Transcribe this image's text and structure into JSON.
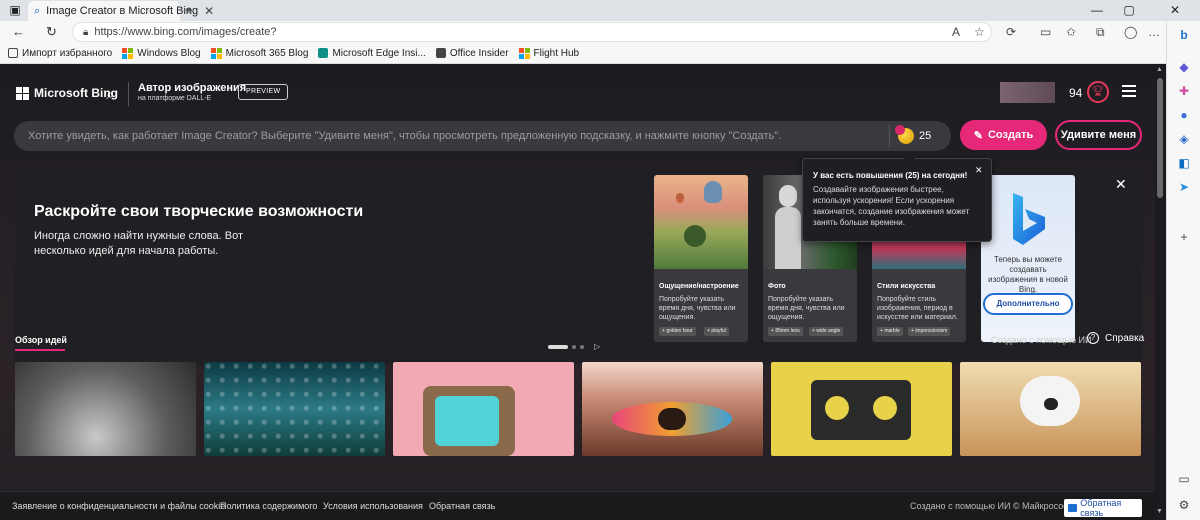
{
  "browser": {
    "tab_title": "Image Creator в Microsoft Bing",
    "url": "https://www.bing.com/images/create?",
    "favorites": [
      {
        "label": "Импорт избранного",
        "color": "#444444",
        "kind": "folder"
      },
      {
        "label": "Windows Blog",
        "color": "#0078d4",
        "kind": "ms"
      },
      {
        "label": "Microsoft 365 Blog",
        "color": "#0078d4",
        "kind": "ms"
      },
      {
        "label": "Microsoft Edge Insi...",
        "color": "#0e8f8a",
        "kind": "edge"
      },
      {
        "label": "Office Insider",
        "color": "#444444",
        "kind": "doc"
      },
      {
        "label": "Flight Hub",
        "color": "#0078d4",
        "kind": "ms"
      }
    ]
  },
  "header": {
    "brand": "Microsoft Bing",
    "title": "Автор изображения",
    "subtitle": "на платформе DALL-E",
    "preview_badge": "PREVIEW",
    "points": "94"
  },
  "prompt": {
    "placeholder": "Хотите увидеть, как работает Image Creator? Выберите \"Удивите меня\", чтобы просмотреть предложенную подсказку, и нажмите кнопку \"Создать\".",
    "boosts": "25",
    "create_label": "Создать",
    "surprise_label": "Удивите меня"
  },
  "panel": {
    "heading": "Раскройте свои творческие возможности",
    "description": "Иногда сложно найти нужные слова. Вот несколько идей для начала работы.",
    "cards": [
      {
        "title": "Ощущение/настроение",
        "desc": "Попробуйте указать время дня, чувства или ощущения.",
        "chips": [
          "golden hour",
          "playful"
        ]
      },
      {
        "title": "Фото",
        "desc": "Попробуйте указать время дня, чувства или ощущения.",
        "chips": [
          "85mm lens",
          "wide angle"
        ]
      },
      {
        "title": "Стили искусства",
        "desc": "Попробуйте стиль изображения, период в искусстве или материал.",
        "chips": [
          "marble",
          "impressionism"
        ]
      }
    ],
    "promo_text": "Теперь вы можете создавать изображения в новой Bing.",
    "promo_button": "Дополнительно"
  },
  "tooltip": {
    "title": "У вас есть повышения (25) на сегодня!",
    "body": "Создавайте изображения быстрее, используя ускорения! Если ускорения закончатся, создание изображения может занять больше времени."
  },
  "ideas": {
    "tab_label": "Обзор идей",
    "ai_made": "Создано с помощью ИИ",
    "help_label": "Справка"
  },
  "footer": {
    "links": [
      "Заявление о конфиденциальности и файлы cookie",
      "Политика содержимого",
      "Условия использования",
      "Обратная связь"
    ],
    "right_text": "Создано с помощью ИИ  © Майкрософт",
    "feedback_button": "Обратная связь"
  },
  "colors": {
    "accent": "#e52877",
    "page_bg": "#1c1c20",
    "promo_blue": "#1f6fd1"
  }
}
